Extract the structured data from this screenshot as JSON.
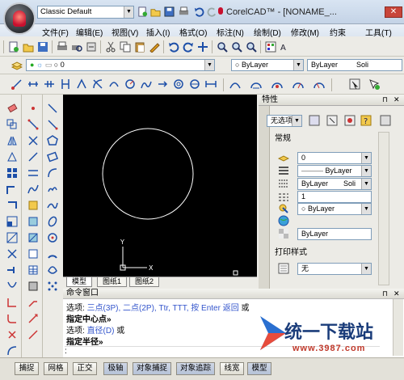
{
  "window": {
    "workspace": "Classic Default",
    "title": "CorelCAD™ - [NONAME_..."
  },
  "menus": [
    "文件(F)",
    "编辑(E)",
    "视图(V)",
    "插入(I)",
    "格式(O)",
    "标注(N)",
    "绘制(D)",
    "修改(M)",
    "约束",
    "工具(T)"
  ],
  "layer_toolbar": {
    "layer_value": "0",
    "color_value": "ByLayer",
    "linetype_value": "ByLayer",
    "lineweight_value": "Soli"
  },
  "properties": {
    "title": "特性",
    "selection": "无选项",
    "general_section": "常规",
    "color": "0",
    "linetype": "ByLayer",
    "lineweight_a": "ByLayer",
    "lineweight_b": "Soli",
    "linetype_scale": "1",
    "plot_color": "ByLayer",
    "transparency": "ByLayer",
    "print_style_section": "打印样式",
    "print_style_value": "无"
  },
  "tabs": [
    "模型",
    "图纸1",
    "图纸2"
  ],
  "command_window": {
    "title": "命令窗口",
    "line1_prefix": "选项: ",
    "line1_options": "三点(3P), 二点(2P), Ttr, TTT, 按 Enter 返回",
    "line1_suffix": " 或",
    "line2": "指定中心点»",
    "line3_prefix": "选项: ",
    "line3_option": "直径(D)",
    "line3_suffix": " 或",
    "line4": "指定半径»",
    "cursor": ":"
  },
  "status": [
    "捕捉",
    "网格",
    "正交",
    "极轴",
    "对象捕捉",
    "对象追踪",
    "线宽",
    "模型"
  ],
  "watermark": {
    "brand": "统一下载站",
    "url": "www.3987.com"
  },
  "ucs": {
    "y": "Y",
    "x": "X"
  }
}
